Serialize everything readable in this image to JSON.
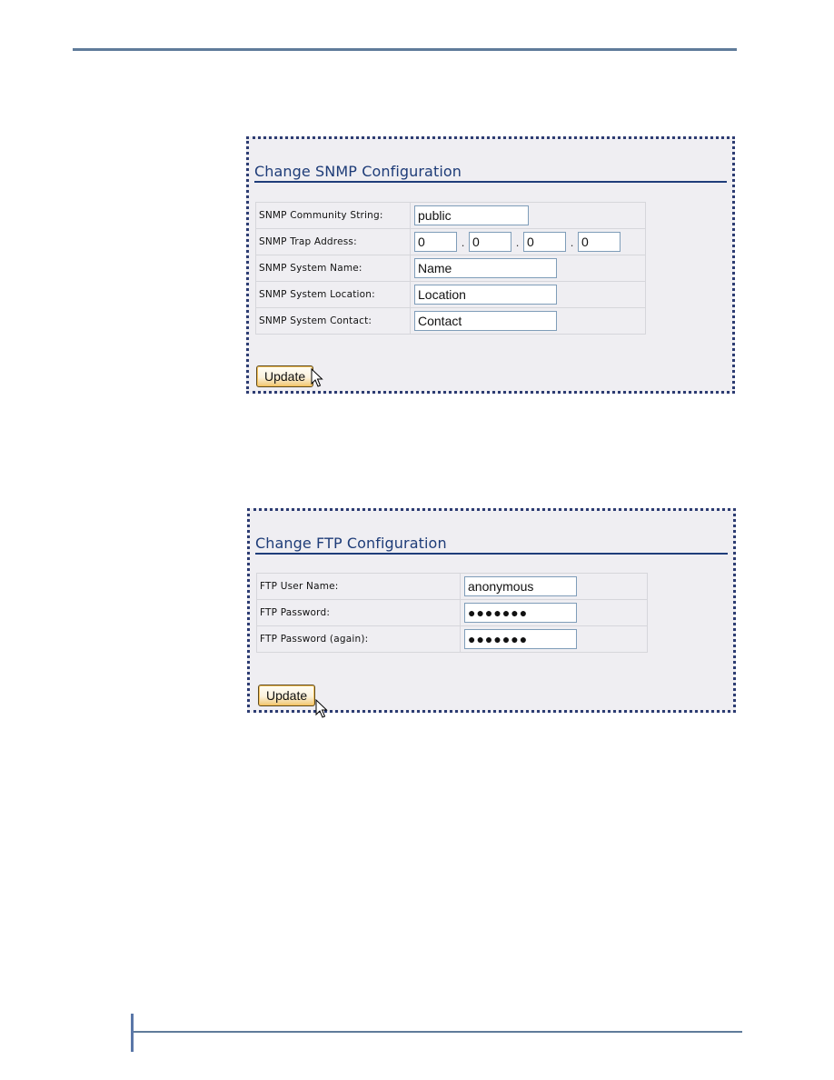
{
  "snmp": {
    "title": "Change SNMP Configuration",
    "fields": {
      "community": {
        "label": "SNMP Community String:",
        "value": "public"
      },
      "trap": {
        "label": "SNMP Trap Address:",
        "octets": [
          "0",
          "0",
          "0",
          "0"
        ],
        "separator": "."
      },
      "name": {
        "label": "SNMP System Name:",
        "value": "Name"
      },
      "location": {
        "label": "SNMP System Location:",
        "value": "Location"
      },
      "contact": {
        "label": "SNMP System Contact:",
        "value": "Contact"
      }
    },
    "update_label": "Update"
  },
  "ftp": {
    "title": "Change FTP Configuration",
    "fields": {
      "user": {
        "label": "FTP User Name:",
        "value": "anonymous"
      },
      "password": {
        "label": "FTP Password:",
        "value": "●●●●●●●"
      },
      "password_again": {
        "label": "FTP Password (again):",
        "value": "●●●●●●●"
      }
    },
    "update_label": "Update"
  },
  "colors": {
    "heading": "#1e3c78",
    "panel_border": "#2c3c72",
    "panel_bg": "#efeef2",
    "rule": "#5f7b9a"
  }
}
